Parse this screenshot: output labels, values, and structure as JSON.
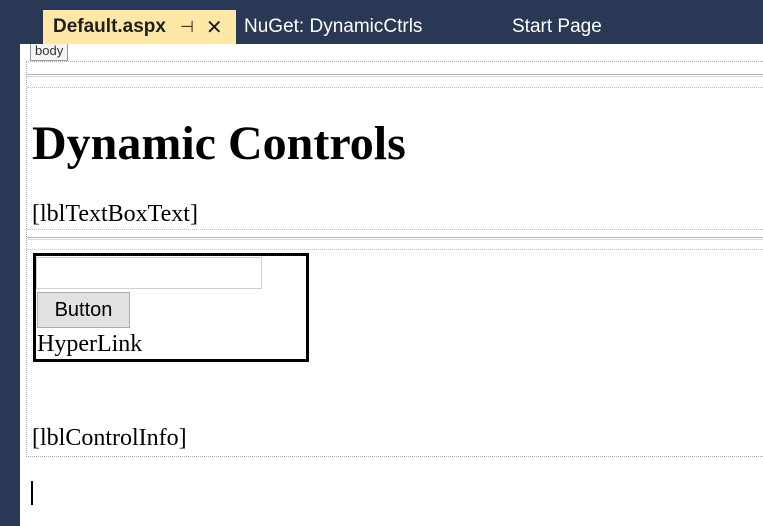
{
  "tabs": {
    "active_label": "Default.aspx",
    "pin_glyph": "⊣",
    "close_glyph": "✕",
    "nuget_label": "NuGet: DynamicCtrls",
    "start_label": "Start Page"
  },
  "designer": {
    "body_tag": "body",
    "heading": "Dynamic Controls",
    "lbl_textbox_text": "[lblTextBoxText]",
    "button_label": "Button",
    "hyperlink_label": "HyperLink",
    "lbl_control_info": "[lblControlInfo]",
    "textbox_value": ""
  },
  "colors": {
    "tab_strip_bg": "#293955",
    "active_tab_bg": "#ffe8a6",
    "inactive_tab_text": "#ffffff"
  }
}
